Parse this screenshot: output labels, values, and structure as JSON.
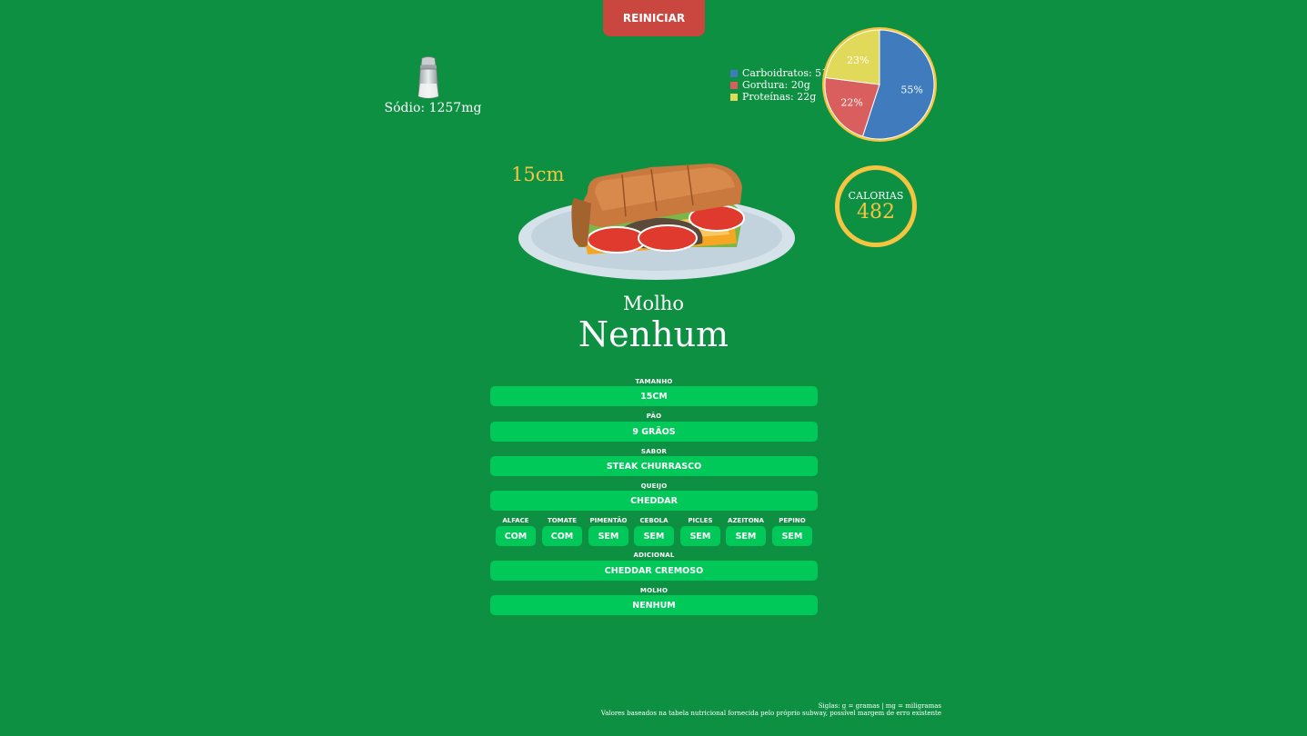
{
  "header": {
    "reset_label": "REINICIAR"
  },
  "sodium": {
    "text": "Sódio: 1257mg"
  },
  "macros": {
    "legend": [
      {
        "text": "Carboidratos: 51g",
        "color": "#3f7bbd"
      },
      {
        "text": "Gordura: 20g",
        "color": "#d95f5f"
      },
      {
        "text": "Proteínas: 22g",
        "color": "#e0d95a"
      }
    ],
    "pie": [
      {
        "percent": 55,
        "label": "55%",
        "color": "#3f7bbd"
      },
      {
        "percent": 22,
        "label": "22%",
        "color": "#d95f5f"
      },
      {
        "percent": 23,
        "label": "23%",
        "color": "#e0d95a"
      }
    ],
    "ring_color": "#f5c542"
  },
  "calories": {
    "label": "CALORIAS",
    "value": "482"
  },
  "sandwich": {
    "size_label": "15cm"
  },
  "sauce": {
    "title": "Molho",
    "value": "Nenhum"
  },
  "options": {
    "tamanho": {
      "label": "TAMANHO",
      "value": "15CM"
    },
    "pao": {
      "label": "PÃO",
      "value": "9 GRÃOS"
    },
    "sabor": {
      "label": "SABOR",
      "value": "STEAK CHURRASCO"
    },
    "queijo": {
      "label": "QUEIJO",
      "value": "CHEDDAR"
    },
    "vegetais": [
      {
        "label": "ALFACE",
        "value": "COM"
      },
      {
        "label": "TOMATE",
        "value": "COM"
      },
      {
        "label": "PIMENTÃO",
        "value": "SEM"
      },
      {
        "label": "CEBOLA",
        "value": "SEM"
      },
      {
        "label": "PICLES",
        "value": "SEM"
      },
      {
        "label": "AZEITONA",
        "value": "SEM"
      },
      {
        "label": "PEPINO",
        "value": "SEM"
      }
    ],
    "adicional": {
      "label": "ADICIONAL",
      "value": "CHEDDAR CREMOSO"
    },
    "molho": {
      "label": "MOLHO",
      "value": "NENHUM"
    }
  },
  "footer": {
    "line1": "Siglas: g = gramas | mg = miligramas",
    "line2": "Valores baseados na tabela nutricional fornecida pelo próprio subway, possível margem de erro existente"
  }
}
